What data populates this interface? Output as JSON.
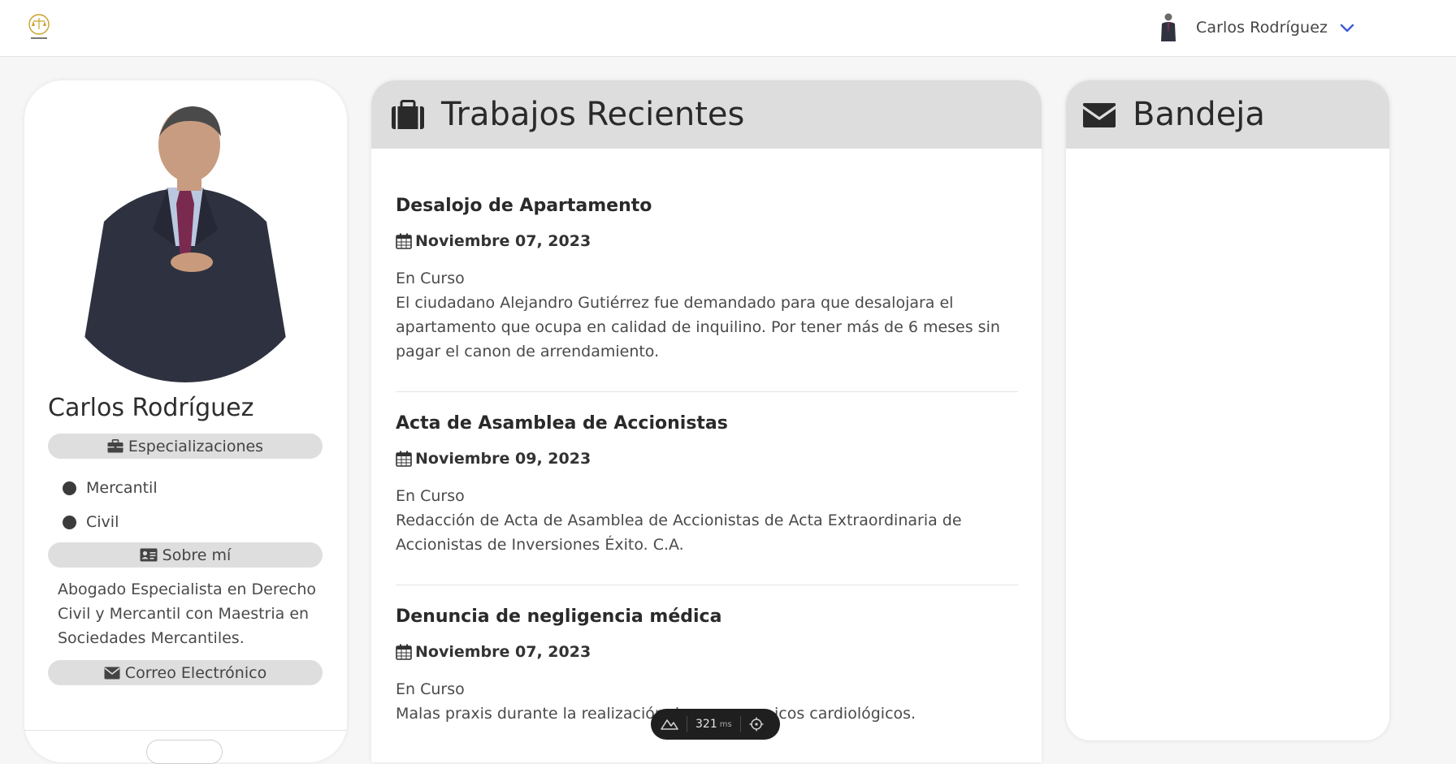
{
  "navbar": {
    "user_name": "Carlos Rodríguez"
  },
  "profile": {
    "name": "Carlos Rodríguez",
    "specializations_label": "Especializaciones",
    "specializations": [
      "Mercantil",
      "Civil"
    ],
    "about_label": "Sobre mí",
    "about_text": "Abogado Especialista en Derecho Civil y Mercantil con Maestria en Sociedades Mercantiles.",
    "email_label": "Correo Electrónico"
  },
  "jobs": {
    "title": "Trabajos Recientes",
    "items": [
      {
        "title": "Desalojo de Apartamento",
        "date": "Noviembre 07, 2023",
        "status": "En Curso",
        "description": "El ciudadano Alejandro Gutiérrez fue demandado para que desalojara el apartamento que ocupa en calidad de inquilino. Por tener más de 6 meses sin pagar el canon de arrendamiento."
      },
      {
        "title": "Acta de Asamblea de Accionistas",
        "date": "Noviembre 09, 2023",
        "status": "En Curso",
        "description": "Redacción de Acta de Asamblea de Accionistas de Acta Extraordinaria de Accionistas de Inversiones Éxito. C.A."
      },
      {
        "title": "Denuncia de negligencia médica",
        "date": "Noviembre 07, 2023",
        "status": "En Curso",
        "description": "Malas praxis durante la realización d",
        "description_tail": "icos cardiológicos."
      }
    ]
  },
  "inbox": {
    "title": "Bandeja"
  },
  "perf": {
    "value": "321",
    "unit": "ms"
  },
  "colors": {
    "header_bg": "#dddddd",
    "pill_bg": "#dedede",
    "accent_chevron": "#3b5bdb",
    "perf_bg": "#1f1f1f"
  }
}
